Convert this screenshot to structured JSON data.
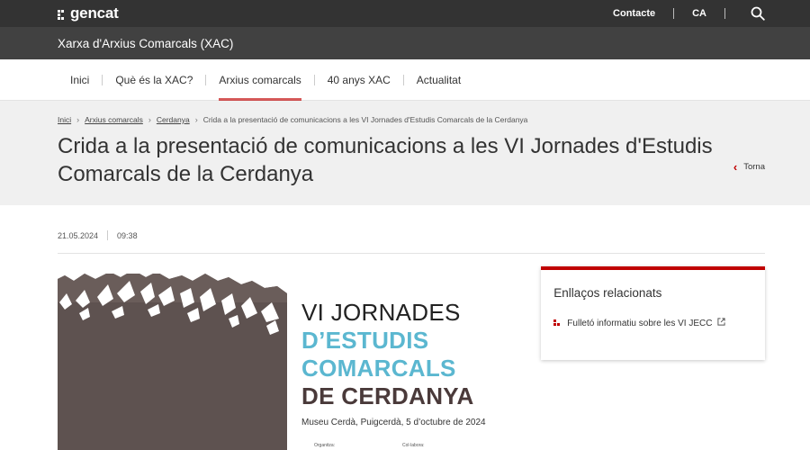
{
  "header": {
    "logo_text": "gencat",
    "contact_label": "Contacte",
    "language_label": "CA",
    "search_icon": "search-icon"
  },
  "subheader": {
    "title": "Xarxa d'Arxius Comarcals (XAC)"
  },
  "nav": {
    "items": [
      {
        "label": "Inici"
      },
      {
        "label": "Què és la XAC?"
      },
      {
        "label": "Arxius comarcals"
      },
      {
        "label": "40 anys XAC"
      },
      {
        "label": "Actualitat"
      }
    ],
    "active_index": 2
  },
  "breadcrumb": {
    "items": [
      "Inici",
      "Arxius comarcals",
      "Cerdanya"
    ],
    "current": "Crida a la presentació de comunicacions a les VI Jornades d'Estudis Comarcals de la Cerdanya"
  },
  "page": {
    "title": "Crida a la presentació de comunicacions a les VI Jornades d'Estudis Comarcals de la Cerdanya",
    "back_label": "Torna",
    "date": "21.05.2024",
    "time": "09:38"
  },
  "poster": {
    "line1": "VI JORNADES",
    "line2": "D’ESTUDIS",
    "line3": "COMARCALS",
    "line4": "DE CERDANYA",
    "subtitle": "Museu Cerdà, Puigcerdà, 5 d’octubre de 2024",
    "organitza": "Organitza:",
    "col_labora": "Col·labora:"
  },
  "sidebar": {
    "title": "Enllaços relacionats",
    "links": [
      {
        "label": "Fulletó informatiu sobre les VI JECC"
      }
    ]
  },
  "colors": {
    "accent": "#c00000",
    "topbar": "#333333",
    "subbar": "#414141",
    "hero_bg": "#f0f0f0",
    "poster_blue": "#5bb7d0",
    "poster_brown": "#4a3a3a"
  }
}
